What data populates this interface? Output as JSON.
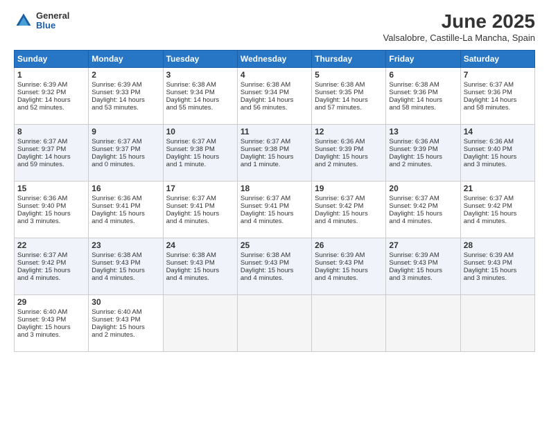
{
  "header": {
    "logo_general": "General",
    "logo_blue": "Blue",
    "title": "June 2025",
    "subtitle": "Valsalobre, Castille-La Mancha, Spain"
  },
  "weekdays": [
    "Sunday",
    "Monday",
    "Tuesday",
    "Wednesday",
    "Thursday",
    "Friday",
    "Saturday"
  ],
  "rows": [
    [
      {
        "day": "1",
        "lines": [
          "Sunrise: 6:39 AM",
          "Sunset: 9:32 PM",
          "Daylight: 14 hours",
          "and 52 minutes."
        ]
      },
      {
        "day": "2",
        "lines": [
          "Sunrise: 6:39 AM",
          "Sunset: 9:33 PM",
          "Daylight: 14 hours",
          "and 53 minutes."
        ]
      },
      {
        "day": "3",
        "lines": [
          "Sunrise: 6:38 AM",
          "Sunset: 9:34 PM",
          "Daylight: 14 hours",
          "and 55 minutes."
        ]
      },
      {
        "day": "4",
        "lines": [
          "Sunrise: 6:38 AM",
          "Sunset: 9:34 PM",
          "Daylight: 14 hours",
          "and 56 minutes."
        ]
      },
      {
        "day": "5",
        "lines": [
          "Sunrise: 6:38 AM",
          "Sunset: 9:35 PM",
          "Daylight: 14 hours",
          "and 57 minutes."
        ]
      },
      {
        "day": "6",
        "lines": [
          "Sunrise: 6:38 AM",
          "Sunset: 9:36 PM",
          "Daylight: 14 hours",
          "and 58 minutes."
        ]
      },
      {
        "day": "7",
        "lines": [
          "Sunrise: 6:37 AM",
          "Sunset: 9:36 PM",
          "Daylight: 14 hours",
          "and 58 minutes."
        ]
      }
    ],
    [
      {
        "day": "8",
        "lines": [
          "Sunrise: 6:37 AM",
          "Sunset: 9:37 PM",
          "Daylight: 14 hours",
          "and 59 minutes."
        ]
      },
      {
        "day": "9",
        "lines": [
          "Sunrise: 6:37 AM",
          "Sunset: 9:37 PM",
          "Daylight: 15 hours",
          "and 0 minutes."
        ]
      },
      {
        "day": "10",
        "lines": [
          "Sunrise: 6:37 AM",
          "Sunset: 9:38 PM",
          "Daylight: 15 hours",
          "and 1 minute."
        ]
      },
      {
        "day": "11",
        "lines": [
          "Sunrise: 6:37 AM",
          "Sunset: 9:38 PM",
          "Daylight: 15 hours",
          "and 1 minute."
        ]
      },
      {
        "day": "12",
        "lines": [
          "Sunrise: 6:36 AM",
          "Sunset: 9:39 PM",
          "Daylight: 15 hours",
          "and 2 minutes."
        ]
      },
      {
        "day": "13",
        "lines": [
          "Sunrise: 6:36 AM",
          "Sunset: 9:39 PM",
          "Daylight: 15 hours",
          "and 2 minutes."
        ]
      },
      {
        "day": "14",
        "lines": [
          "Sunrise: 6:36 AM",
          "Sunset: 9:40 PM",
          "Daylight: 15 hours",
          "and 3 minutes."
        ]
      }
    ],
    [
      {
        "day": "15",
        "lines": [
          "Sunrise: 6:36 AM",
          "Sunset: 9:40 PM",
          "Daylight: 15 hours",
          "and 3 minutes."
        ]
      },
      {
        "day": "16",
        "lines": [
          "Sunrise: 6:36 AM",
          "Sunset: 9:41 PM",
          "Daylight: 15 hours",
          "and 4 minutes."
        ]
      },
      {
        "day": "17",
        "lines": [
          "Sunrise: 6:37 AM",
          "Sunset: 9:41 PM",
          "Daylight: 15 hours",
          "and 4 minutes."
        ]
      },
      {
        "day": "18",
        "lines": [
          "Sunrise: 6:37 AM",
          "Sunset: 9:41 PM",
          "Daylight: 15 hours",
          "and 4 minutes."
        ]
      },
      {
        "day": "19",
        "lines": [
          "Sunrise: 6:37 AM",
          "Sunset: 9:42 PM",
          "Daylight: 15 hours",
          "and 4 minutes."
        ]
      },
      {
        "day": "20",
        "lines": [
          "Sunrise: 6:37 AM",
          "Sunset: 9:42 PM",
          "Daylight: 15 hours",
          "and 4 minutes."
        ]
      },
      {
        "day": "21",
        "lines": [
          "Sunrise: 6:37 AM",
          "Sunset: 9:42 PM",
          "Daylight: 15 hours",
          "and 4 minutes."
        ]
      }
    ],
    [
      {
        "day": "22",
        "lines": [
          "Sunrise: 6:37 AM",
          "Sunset: 9:42 PM",
          "Daylight: 15 hours",
          "and 4 minutes."
        ]
      },
      {
        "day": "23",
        "lines": [
          "Sunrise: 6:38 AM",
          "Sunset: 9:43 PM",
          "Daylight: 15 hours",
          "and 4 minutes."
        ]
      },
      {
        "day": "24",
        "lines": [
          "Sunrise: 6:38 AM",
          "Sunset: 9:43 PM",
          "Daylight: 15 hours",
          "and 4 minutes."
        ]
      },
      {
        "day": "25",
        "lines": [
          "Sunrise: 6:38 AM",
          "Sunset: 9:43 PM",
          "Daylight: 15 hours",
          "and 4 minutes."
        ]
      },
      {
        "day": "26",
        "lines": [
          "Sunrise: 6:39 AM",
          "Sunset: 9:43 PM",
          "Daylight: 15 hours",
          "and 4 minutes."
        ]
      },
      {
        "day": "27",
        "lines": [
          "Sunrise: 6:39 AM",
          "Sunset: 9:43 PM",
          "Daylight: 15 hours",
          "and 3 minutes."
        ]
      },
      {
        "day": "28",
        "lines": [
          "Sunrise: 6:39 AM",
          "Sunset: 9:43 PM",
          "Daylight: 15 hours",
          "and 3 minutes."
        ]
      }
    ],
    [
      {
        "day": "29",
        "lines": [
          "Sunrise: 6:40 AM",
          "Sunset: 9:43 PM",
          "Daylight: 15 hours",
          "and 3 minutes."
        ]
      },
      {
        "day": "30",
        "lines": [
          "Sunrise: 6:40 AM",
          "Sunset: 9:43 PM",
          "Daylight: 15 hours",
          "and 2 minutes."
        ]
      },
      {
        "day": "",
        "lines": []
      },
      {
        "day": "",
        "lines": []
      },
      {
        "day": "",
        "lines": []
      },
      {
        "day": "",
        "lines": []
      },
      {
        "day": "",
        "lines": []
      }
    ]
  ]
}
